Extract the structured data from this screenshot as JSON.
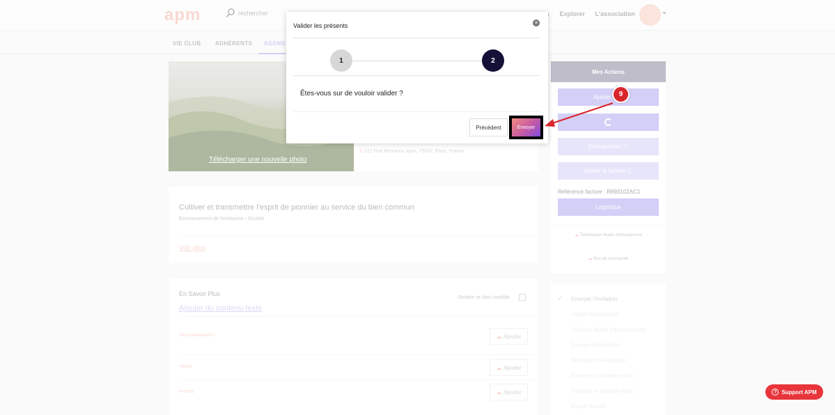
{
  "header": {
    "logo": "apm",
    "search_placeholder": "rechercher",
    "nav": [
      "s",
      "Explorer",
      "L'association"
    ]
  },
  "tabs": [
    "VIE CLUB",
    "ADHÉRENTS",
    "AGENDA"
  ],
  "event": {
    "photo_link": "Télécharger une nouvelle photo",
    "address": "122 Rue Réaumur, Apm, 75002, Paris, France"
  },
  "about": {
    "title": "Cultiver et transmettre l'esprit de pionnier au service du bien commun",
    "subtitle": "Environnement de l'entreprise › Société",
    "more": "Voir plus"
  },
  "savoir": {
    "title": "En Savoir Plus",
    "add_text": "Ajouter du contenu texte",
    "invisible_label": "Rendre ce bloc invisible",
    "media": [
      {
        "label": "TÉLÉCHARGEMENTS",
        "button": "Ajouter"
      },
      {
        "label": "VIDÉOS",
        "button": "Ajouter"
      },
      {
        "label": "PHOTOS",
        "button": "Ajouter"
      }
    ]
  },
  "actions": {
    "title": "Mes Actions",
    "add_button": "Ajouter un...",
    "emargement": "Émargement ⓘ",
    "valider_facture": "Valider la facture ⓘ",
    "ref_facture": "Référence facture : R893102AC1",
    "logistique": "Logistique",
    "link_feuille": "Télécharger feuille d'émargement",
    "link_bon": "Bon de commande"
  },
  "steps": [
    "Envoyer l'invitation",
    "Valider la présence",
    "Déposer feuille d'émargement",
    "Envoyer l'évaluation",
    "Récupérer l'évaluation",
    "Envoyer le compte rendu",
    "Partager le compte rendu",
    "Export facture"
  ],
  "support": "Support APM",
  "modal": {
    "title": "Valider les présents",
    "step1": "1",
    "step2": "2",
    "question": "Êtes-vous sur de vouloir valider ?",
    "prev": "Précédent",
    "send": "Envoyer"
  },
  "annotation": {
    "badge": "9",
    "color": "#d9262c"
  },
  "colors": {
    "accent": "#a79fef",
    "step_active": "#141037",
    "support": "#e8353b"
  }
}
